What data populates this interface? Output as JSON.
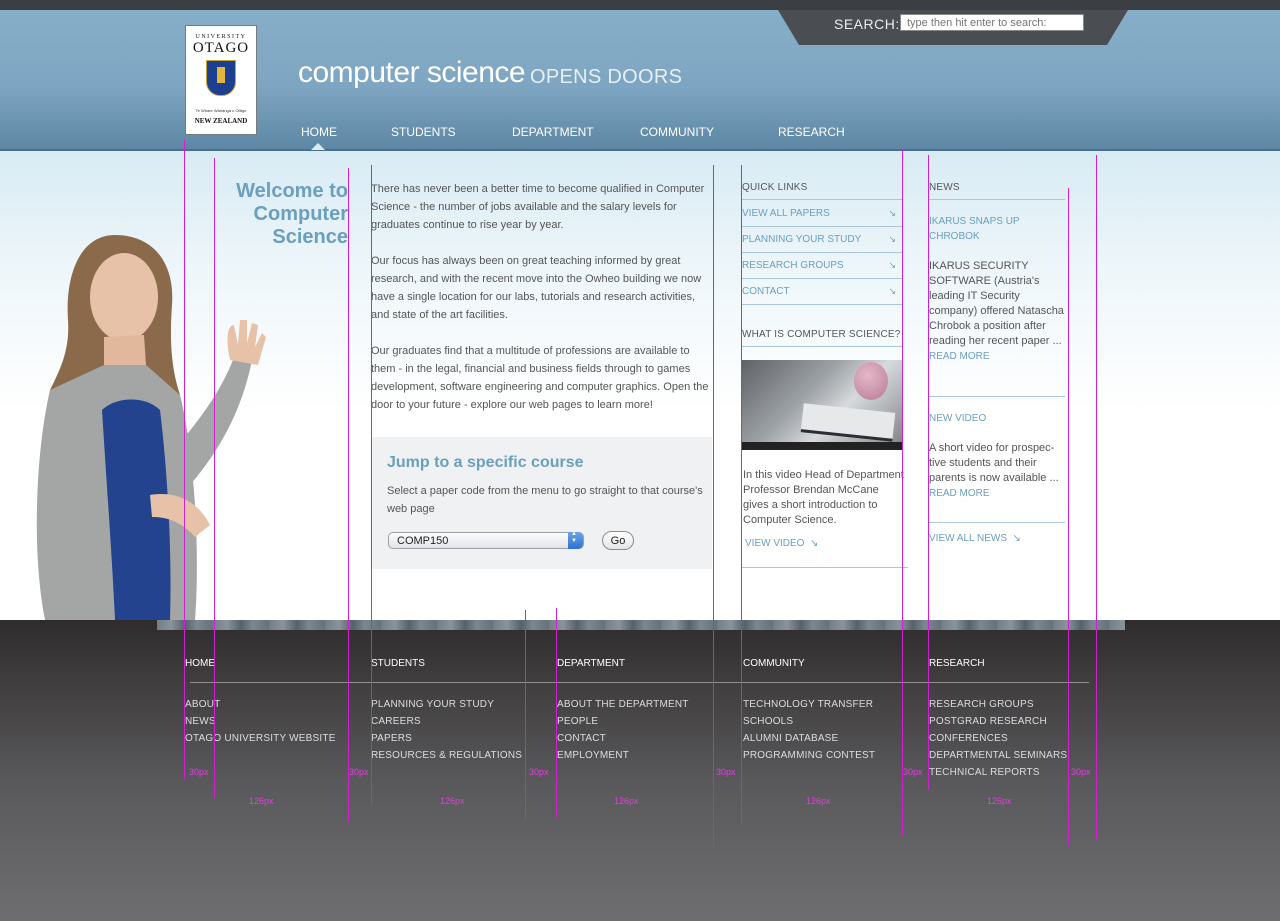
{
  "search": {
    "label": "SEARCH:",
    "placeholder": "type then hit enter to search:"
  },
  "logo": {
    "university": "UNIVERSITY",
    "of": "OF",
    "name": "OTAGO",
    "motto": "Te Whare Wānanga o Otāgo",
    "country": "NEW ZEALAND"
  },
  "header": {
    "title": "computer science",
    "tagline": "OPENS DOORS"
  },
  "nav": [
    "HOME",
    "STUDENTS",
    "DEPARTMENT",
    "COMMUNITY",
    "RESEARCH"
  ],
  "welcome": "Welcome to Computer Science",
  "intro": [
    "There has never been a better time to become qualified in Computer Science - the number of jobs available and the salary levels for graduates continue to rise year by year.",
    "Our focus has always been on great teaching informed by great research, and with the recent move into the Owheo building we now have a single location for our labs, tutorials and research activities, and state of the art facilities.",
    "Our graduates find that a multitude of professions are available to them - in the legal, financial and business fields through to games development, software engineering and computer graphics. Open the door to your future - explore our web pages to learn more!"
  ],
  "jump": {
    "title": "Jump to a specific course",
    "description": "Select a paper code from the menu to go straight to that course's web page",
    "selected": "COMP150",
    "go": "Go"
  },
  "quick_links": {
    "heading": "QUICK LINKS",
    "items": [
      "VIEW ALL PAPERS",
      "PLANNING YOUR STUDY",
      "RESEARCH GROUPS",
      "CONTACT"
    ]
  },
  "what_is": {
    "heading": "WHAT IS COMPUTER SCIENCE?",
    "text": "In this video Head of Department Professor Brendan McCane gives a short introduction to Computer Science.",
    "link": "VIEW VIDEO"
  },
  "news": {
    "heading": "NEWS",
    "item1_title": "IKARUS SNAPS UP CHROBOK",
    "item1_text": "IKARUS SECURITY SOFTWARE (Austria's leading IT Security company) offered Natascha Chrobok a position after reading her recent paper ...",
    "read_more": "READ MORE",
    "item2_title": "NEW VIDEO",
    "item2_text": "A short video for prospec-tive students and their parents is now available ...",
    "view_all": "VIEW ALL NEWS"
  },
  "footer": {
    "columns": [
      {
        "head": "HOME",
        "links": [
          "ABOUT",
          "NEWS",
          "OTAGO UNIVERSITY WEBSITE"
        ]
      },
      {
        "head": "STUDENTS",
        "links": [
          "PLANNING YOUR STUDY",
          "CAREERS",
          "PAPERS",
          "RESOURCES & REGULATIONS"
        ]
      },
      {
        "head": "DEPARTMENT",
        "links": [
          "ABOUT THE DEPARTMENT",
          "PEOPLE",
          "CONTACT",
          "EMPLOYMENT"
        ]
      },
      {
        "head": "COMMUNITY",
        "links": [
          "TECHNOLOGY TRANSFER",
          "SCHOOLS",
          "ALUMNI DATABASE",
          "PROGRAMMING CONTEST"
        ]
      },
      {
        "head": "RESEARCH",
        "links": [
          "RESEARCH GROUPS",
          "POSTGRAD RESEARCH",
          "CONFERENCES",
          "DEPARTMENTAL SEMINARS",
          "TECHNICAL REPORTS"
        ]
      }
    ]
  },
  "guides": {
    "gap_labels": [
      "30px",
      "30px",
      "30px",
      "30px",
      "30px",
      "30px"
    ],
    "width_labels": [
      "126px",
      "126px",
      "126px",
      "126px",
      "126px"
    ]
  },
  "colors": {
    "accent": "#6a9fbd",
    "header": "#7ea6c2",
    "footer": "#3f3d3e",
    "guide": "#d020d0"
  }
}
